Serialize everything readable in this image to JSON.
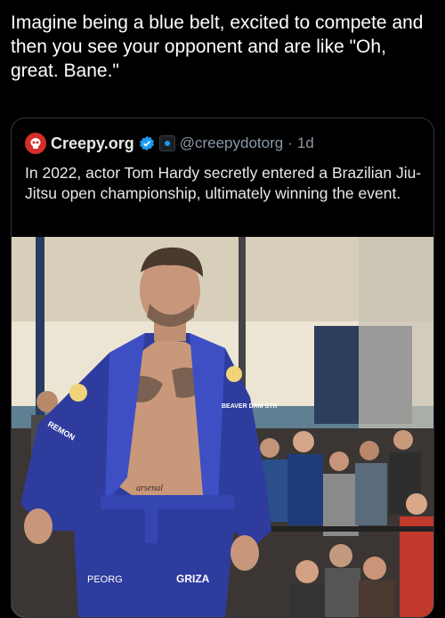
{
  "post": {
    "caption": "Imagine being a blue belt, excited to compete and then you see your opponent and are like \"Oh, great. Bane.\""
  },
  "quoted": {
    "display_name": "Creepy.org",
    "handle": "@creepydotorg",
    "separator": "·",
    "time": "1d",
    "text": "In 2022, actor Tom Hardy secretly entered a Brazilian Jiu-Jitsu open championship, ultimately winning the event.",
    "verified_icon": "verified-badge-icon",
    "affiliate_icon": "affiliate-badge-icon",
    "avatar_icon": "skull-icon"
  },
  "photo": {
    "gi_patches": {
      "left_sleeve": "REMON",
      "chest": "BEAVER DAM STR",
      "left_leg": "PEORG",
      "right_leg": "GRIZA",
      "belt_tattoo": "arsenal"
    }
  },
  "colors": {
    "background": "#000000",
    "text": "#e7e9ea",
    "muted": "#8b98a5",
    "verified": "#1d9bf0",
    "gi_blue": "#2e3c9e",
    "avatar_red": "#d42e27"
  }
}
